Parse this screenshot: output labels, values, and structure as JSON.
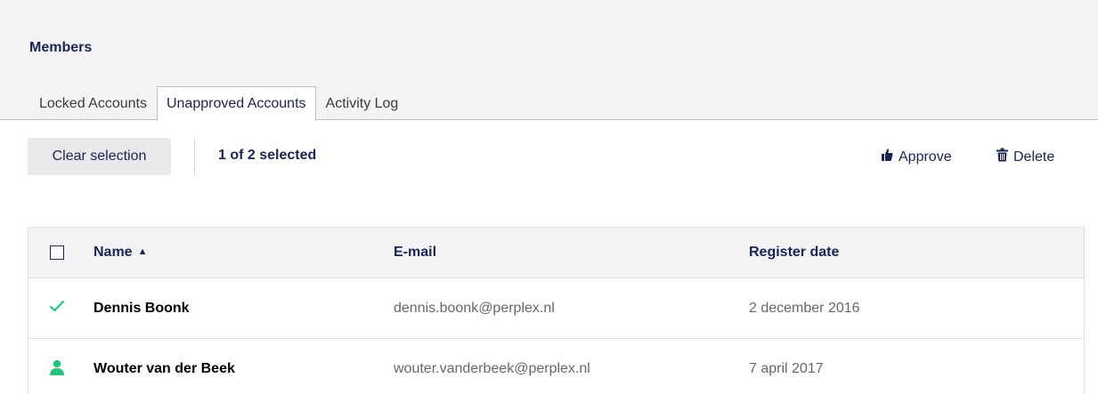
{
  "page_title": "Members",
  "tabs": [
    {
      "label": "Locked Accounts",
      "active": false
    },
    {
      "label": "Unapproved Accounts",
      "active": true
    },
    {
      "label": "Activity Log",
      "active": false
    }
  ],
  "toolbar": {
    "clear_label": "Clear selection",
    "selection_count": "1 of 2 selected",
    "approve_label": "Approve",
    "approve_icon": "thumbs-up-icon",
    "delete_label": "Delete",
    "delete_icon": "trash-icon"
  },
  "table": {
    "columns": {
      "name": "Name",
      "email": "E-mail",
      "register_date": "Register date"
    },
    "sort": {
      "column": "name",
      "direction": "ascending"
    },
    "rows": [
      {
        "name": "Dennis Boonk",
        "email": "dennis.boonk@perplex.nl",
        "register_date": "2 december 2016",
        "selected": true,
        "icon": "checkmark-icon"
      },
      {
        "name": "Wouter van der Beek",
        "email": "wouter.vanderbeek@perplex.nl",
        "register_date": "7 april 2017",
        "selected": false,
        "icon": "user-icon"
      }
    ]
  },
  "colors": {
    "accent_green": "#2bc37c",
    "text_dark": "#1b264f",
    "text_muted": "#68676b",
    "header_bg": "#f3f3f5"
  }
}
